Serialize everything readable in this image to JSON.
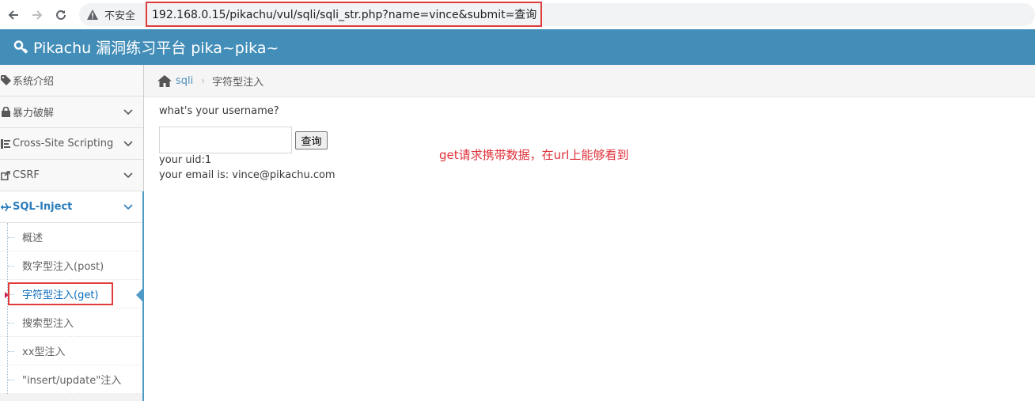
{
  "browser": {
    "insecure_label": "不安全",
    "url": "192.168.0.15/pikachu/vul/sqli/sqli_str.php?name=vince&submit=查询"
  },
  "header": {
    "title": "Pikachu 漏洞练习平台 pika~pika~"
  },
  "sidebar": {
    "items": [
      {
        "label": "系统介绍",
        "icon": "tag-icon",
        "has_chevron": false
      },
      {
        "label": "暴力破解",
        "icon": "lock-icon",
        "has_chevron": true
      },
      {
        "label": "Cross-Site Scripting",
        "icon": "list-icon",
        "has_chevron": true
      },
      {
        "label": "CSRF",
        "icon": "share-icon",
        "has_chevron": true
      },
      {
        "label": "SQL-Inject",
        "icon": "plane-icon",
        "has_chevron": true,
        "active": true
      }
    ],
    "subitems": [
      {
        "label": "概述"
      },
      {
        "label": "数字型注入(post)"
      },
      {
        "label": "字符型注入(get)",
        "active": true
      },
      {
        "label": "搜索型注入"
      },
      {
        "label": "xx型注入"
      },
      {
        "label": "\"insert/update\"注入"
      }
    ]
  },
  "breadcrumb": {
    "link": "sqli",
    "current": "字符型注入"
  },
  "main": {
    "question": "what's your username?",
    "input_value": "",
    "button_label": "查询",
    "result_uid": "your uid:1",
    "result_email": "your email is: vince@pikachu.com",
    "annotation": "get请求携带数据，在url上能够看到"
  },
  "colors": {
    "header_bg": "#438eb9",
    "accent": "#2b7dbc",
    "highlight_red": "#e03c3c"
  }
}
